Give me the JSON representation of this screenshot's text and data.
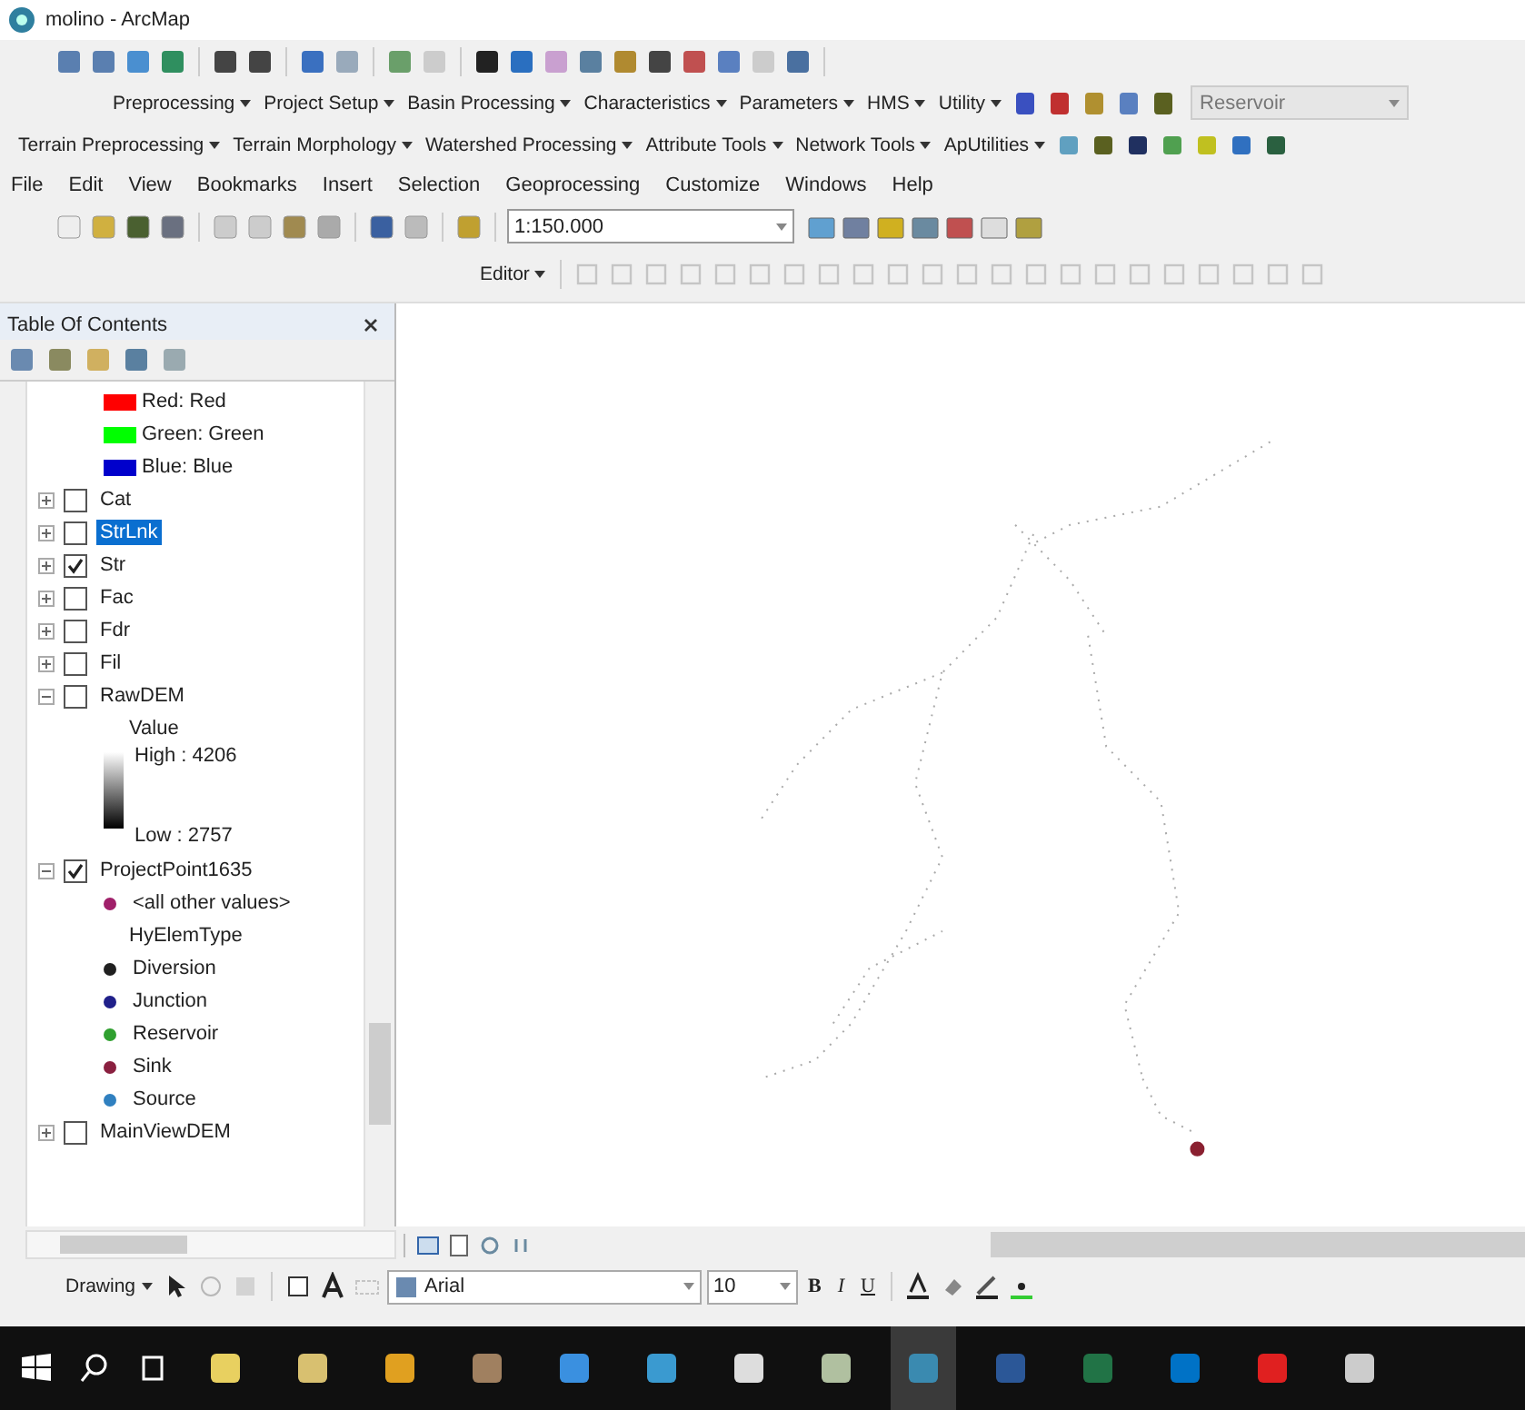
{
  "window": {
    "title": "molino - ArcMap"
  },
  "hydro_toolbar": {
    "menus": [
      "Preprocessing",
      "Project Setup",
      "Basin Processing",
      "Characteristics",
      "Parameters",
      "HMS",
      "Utility"
    ],
    "dropdown": {
      "value": "Reservoir"
    }
  },
  "archydro_toolbar": {
    "menus": [
      "Terrain Preprocessing",
      "Terrain Morphology",
      "Watershed Processing",
      "Attribute Tools",
      "Network Tools",
      "ApUtilities"
    ]
  },
  "menu_bar": [
    "File",
    "Edit",
    "View",
    "Bookmarks",
    "Insert",
    "Selection",
    "Geoprocessing",
    "Customize",
    "Windows",
    "Help"
  ],
  "standard_toolbar": {
    "scale": "1:150.000"
  },
  "editor_toolbar": {
    "menu": "Editor"
  },
  "toc": {
    "title": "Table Of Contents",
    "legend": [
      {
        "label": "Red:",
        "value": "Red",
        "color": "#ff0000"
      },
      {
        "label": "Green:",
        "value": "Green",
        "color": "#00ff00"
      },
      {
        "label": "Blue:",
        "value": "Blue",
        "color": "#0000cc"
      }
    ],
    "layers": [
      {
        "name": "Cat",
        "checked": false,
        "expanded": false,
        "selected": false
      },
      {
        "name": "StrLnk",
        "checked": false,
        "expanded": false,
        "selected": true
      },
      {
        "name": "Str",
        "checked": true,
        "expanded": false,
        "selected": false
      },
      {
        "name": "Fac",
        "checked": false,
        "expanded": false,
        "selected": false
      },
      {
        "name": "Fdr",
        "checked": false,
        "expanded": false,
        "selected": false
      },
      {
        "name": "Fil",
        "checked": false,
        "expanded": false,
        "selected": false
      },
      {
        "name": "RawDEM",
        "checked": false,
        "expanded": true,
        "selected": false,
        "children": [
          {
            "kind": "heading",
            "label": "Value"
          },
          {
            "kind": "ramp",
            "high": "High : 4206",
            "low": "Low : 2757"
          }
        ]
      },
      {
        "name": "ProjectPoint1635",
        "checked": true,
        "expanded": true,
        "selected": false,
        "children": [
          {
            "kind": "symbol",
            "label": "<all other values>",
            "color": "#a0206a"
          },
          {
            "kind": "heading",
            "label": "HyElemType"
          },
          {
            "kind": "symbol",
            "label": "Diversion",
            "color": "#202020"
          },
          {
            "kind": "symbol",
            "label": "Junction",
            "color": "#20208a"
          },
          {
            "kind": "symbol",
            "label": "Reservoir",
            "color": "#30a030"
          },
          {
            "kind": "symbol",
            "label": "Sink",
            "color": "#8a2040"
          },
          {
            "kind": "symbol",
            "label": "Source",
            "color": "#3080c0"
          }
        ]
      },
      {
        "name": "MainViewDEM",
        "checked": false,
        "expanded": false,
        "selected": false
      }
    ]
  },
  "drawing_toolbar": {
    "menu": "Drawing",
    "font": "Arial",
    "size": "10",
    "styles": [
      "B",
      "I",
      "U"
    ]
  },
  "taskbar": {
    "apps": [
      {
        "selected": false
      },
      {
        "selected": false
      },
      {
        "selected": false
      },
      {
        "selected": false
      },
      {
        "selected": false
      },
      {
        "selected": false
      },
      {
        "selected": false
      },
      {
        "selected": false
      },
      {
        "selected": true
      },
      {
        "selected": false
      },
      {
        "selected": false
      },
      {
        "selected": false
      },
      {
        "selected": false
      },
      {
        "selected": false
      }
    ]
  }
}
